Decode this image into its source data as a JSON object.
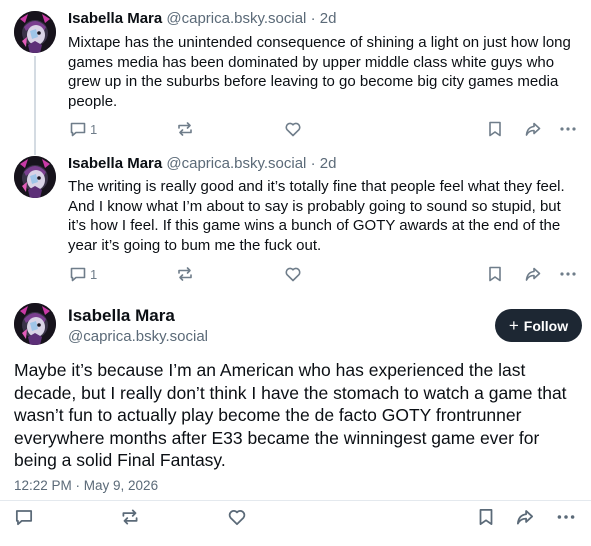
{
  "posts": [
    {
      "author": "Isabella Mara",
      "handle": "@caprica.bsky.social",
      "dot": "·",
      "age": "2d",
      "text": "Mixtape has the unintended consequence of shining a light on just how long games media has been dominated by upper middle class white guys who grew up in the suburbs before leaving to go become big city games media people.",
      "reply_count": "1"
    },
    {
      "author": "Isabella Mara",
      "handle": "@caprica.bsky.social",
      "dot": "·",
      "age": "2d",
      "text": "The writing is really good and it’s totally fine that people feel what they feel. And I know what I’m about to say is probably going to sound so stupid, but it’s how I feel. If this game wins a bunch of GOTY awards at the end of the year it’s going to bum me the fuck out.",
      "reply_count": "1"
    }
  ],
  "main_post": {
    "author": "Isabella Mara",
    "handle": "@caprica.bsky.social",
    "follow_label": "Follow",
    "follow_plus": "+",
    "text": "Maybe it’s because I’m an American who has experienced the last decade, but I really don’t think I have the stomach to watch a game that wasn’t fun to actually play become the de facto GOTY frontrunner everywhere months after E33 became the winningest game ever for being a solid Final Fantasy.",
    "timestamp": "12:22 PM · May 9, 2026"
  },
  "icons": {
    "reply": "reply-icon",
    "repost": "repost-icon",
    "like": "heart-icon",
    "bookmark": "bookmark-icon",
    "share": "share-icon",
    "more": "more-icon"
  },
  "colors": {
    "text": "#0b0f14",
    "muted": "#5b6a78",
    "icon": "#6f7d8a",
    "follow_bg": "#1d2733",
    "thread_line": "#d4dbe2"
  }
}
